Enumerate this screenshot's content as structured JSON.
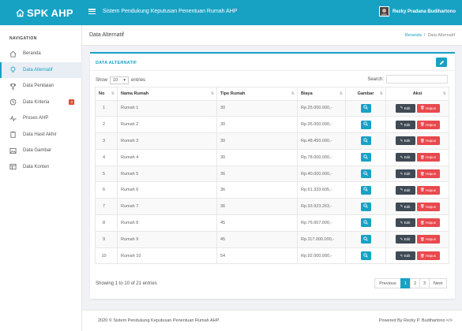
{
  "brand": "SPK AHP",
  "app_title": "Sistem Pendukung Keputusan Penentuan Rumah AHP",
  "user_name": "Rezky Pradana Budihartono",
  "sidebar": {
    "heading": "NAVIGATION",
    "items": [
      {
        "label": "Beranda",
        "icon": "home-icon"
      },
      {
        "label": "Data Alternatif",
        "icon": "lightbulb-icon",
        "active": true
      },
      {
        "label": "Data Penilaian",
        "icon": "trophy-icon"
      },
      {
        "label": "Data Kriteria",
        "icon": "clock-icon",
        "badge": "3"
      },
      {
        "label": "Proses AHP",
        "icon": "activity-icon"
      },
      {
        "label": "Data Hasil Akhir",
        "icon": "clipboard-icon"
      },
      {
        "label": "Data Gambar",
        "icon": "image-icon"
      },
      {
        "label": "Data Konten",
        "icon": "layout-icon"
      }
    ]
  },
  "page": {
    "title": "Data Alternatif",
    "breadcrumb": [
      "Beranda",
      "Data Alternatif"
    ]
  },
  "card": {
    "title": "DATA ALTERNATIF",
    "show_label": "Show",
    "entries_value": "10",
    "entries_label": "entries",
    "search_label": "Search:"
  },
  "table": {
    "headers": [
      "No",
      "Nama Rumah",
      "Tipe Rumah",
      "Biaya",
      "Gambar",
      "Aksi"
    ],
    "edit_label": "Edit",
    "delete_label": "Hapus",
    "rows": [
      {
        "no": "1",
        "nama": "Rumah 1",
        "tipe": "30",
        "biaya": "Rp.25.000.000,-"
      },
      {
        "no": "2",
        "nama": "Rumah 2",
        "tipe": "30",
        "biaya": "Rp.35.000.000,-"
      },
      {
        "no": "3",
        "nama": "Rumah 3",
        "tipe": "30",
        "biaya": "Rp.48.450.000,-"
      },
      {
        "no": "4",
        "nama": "Rumah 4",
        "tipe": "30",
        "biaya": "Rp.78.000.000,-"
      },
      {
        "no": "5",
        "nama": "Rumah 5",
        "tipe": "36",
        "biaya": "Rp.40.000.000,-"
      },
      {
        "no": "6",
        "nama": "Rumah 6",
        "tipe": "36",
        "biaya": "Rp.61.333.605,-"
      },
      {
        "no": "7",
        "nama": "Rumah 7",
        "tipe": "36",
        "biaya": "Rp.93.923.263,-"
      },
      {
        "no": "8",
        "nama": "Rumah 8",
        "tipe": "45",
        "biaya": "Rp.76.667.000,-"
      },
      {
        "no": "9",
        "nama": "Rumah 9",
        "tipe": "45",
        "biaya": "Rp.117.000.000,-"
      },
      {
        "no": "10",
        "nama": "Rumah 10",
        "tipe": "54",
        "biaya": "Rp.92.000.000,-"
      }
    ]
  },
  "pagination": {
    "info": "Showing 1 to 10 of 21 entries",
    "previous": "Previous",
    "pages": [
      "1",
      "2",
      "3"
    ],
    "current": "1",
    "next": "Next"
  },
  "footer": {
    "left": "2020 © Sistem Pendukung Keputusan Penentuan Rumah AHP.",
    "right": "Powered By Rezky P. Budihartono </>"
  },
  "colors": {
    "accent": "#17a2c4",
    "edit": "#3f4a55",
    "delete": "#e8494d",
    "badge": "#dd4b39"
  }
}
